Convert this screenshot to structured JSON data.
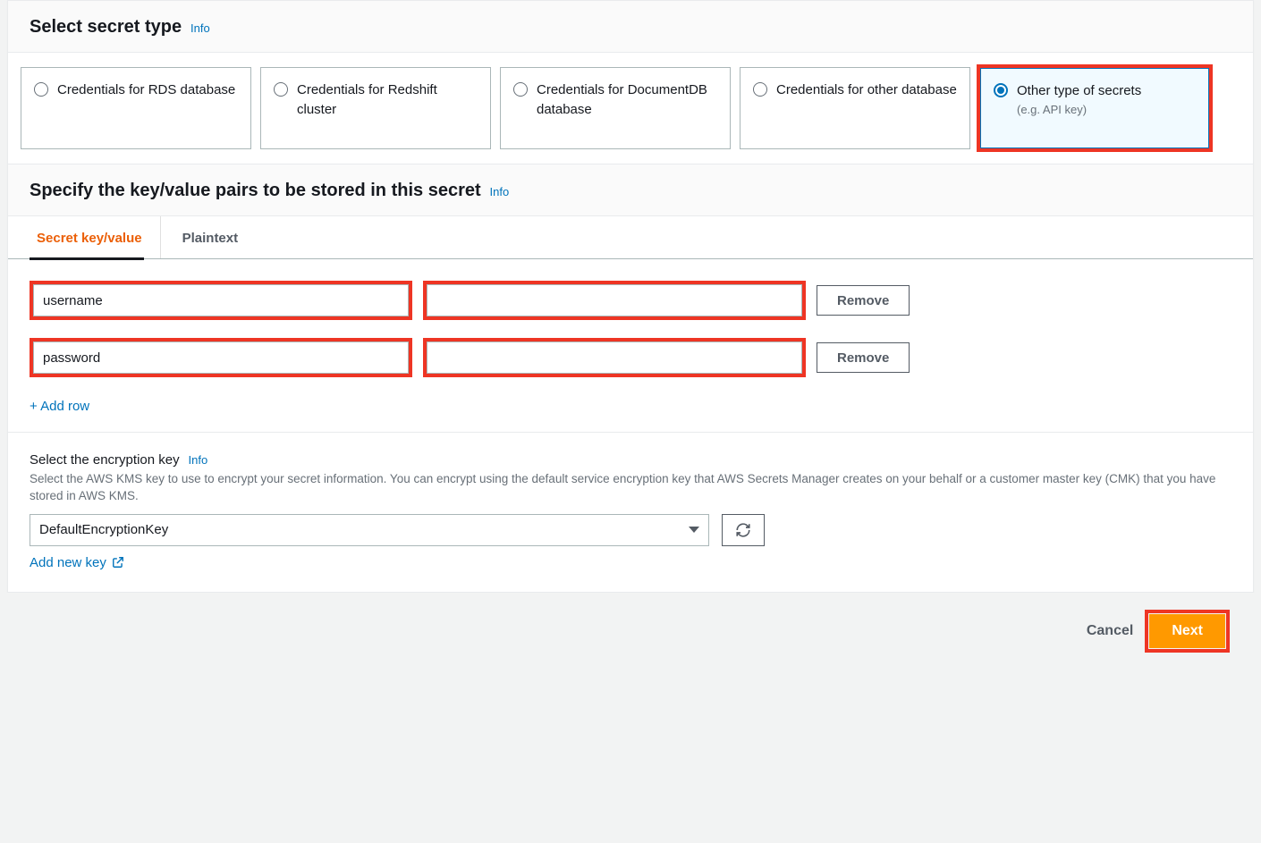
{
  "section1": {
    "title": "Select secret type",
    "info": "Info"
  },
  "types": [
    {
      "label": "Credentials for RDS database",
      "sub": "",
      "selected": false
    },
    {
      "label": "Credentials for Redshift cluster",
      "sub": "",
      "selected": false
    },
    {
      "label": "Credentials for DocumentDB database",
      "sub": "",
      "selected": false
    },
    {
      "label": "Credentials for other database",
      "sub": "",
      "selected": false
    },
    {
      "label": "Other type of secrets",
      "sub": "(e.g. API key)",
      "selected": true
    }
  ],
  "section2": {
    "title": "Specify the key/value pairs to be stored in this secret",
    "info": "Info"
  },
  "tabs": {
    "kv": "Secret key/value",
    "plain": "Plaintext"
  },
  "rows": [
    {
      "key": "username",
      "value": "",
      "remove": "Remove"
    },
    {
      "key": "password",
      "value": "",
      "remove": "Remove"
    }
  ],
  "add_row": "+ Add row",
  "encryption": {
    "title": "Select the encryption key",
    "info": "Info",
    "desc": "Select the AWS KMS key to use to encrypt your secret information. You can encrypt using the default service encryption key that AWS Secrets Manager creates on your behalf or a customer master key (CMK) that you have stored in AWS KMS.",
    "selected": "DefaultEncryptionKey",
    "add_new": "Add new key"
  },
  "footer": {
    "cancel": "Cancel",
    "next": "Next"
  }
}
